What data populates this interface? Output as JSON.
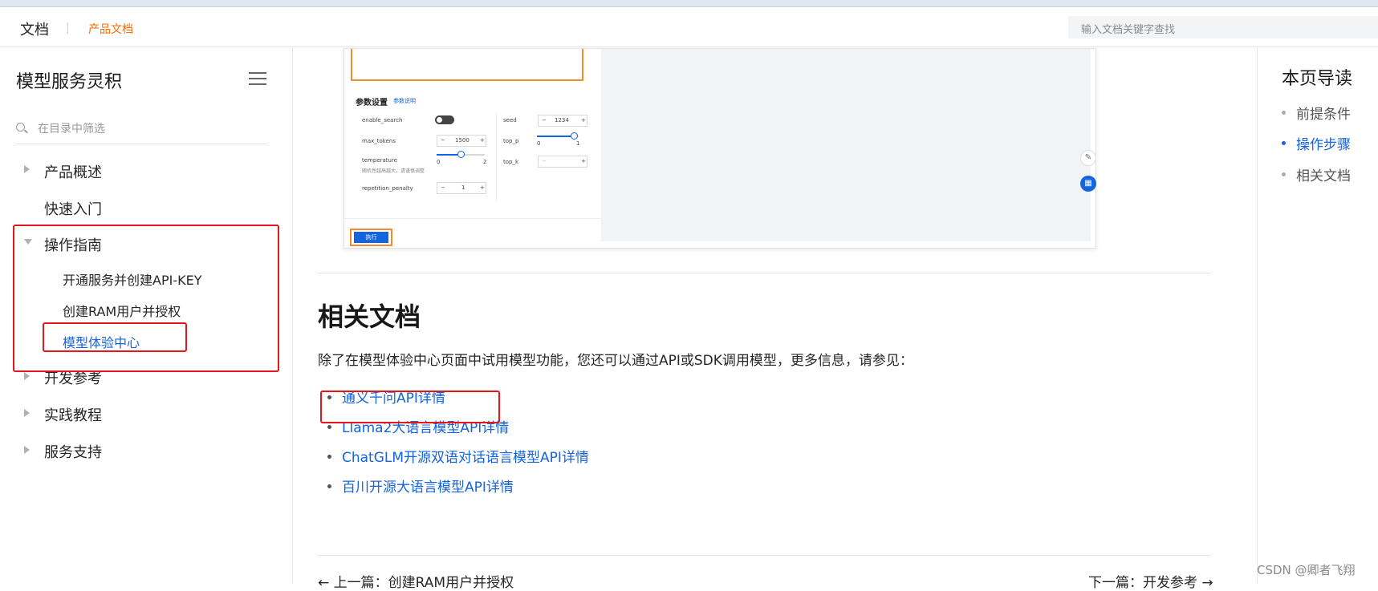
{
  "header": {
    "brand": "文档",
    "breadcrumb": "产品文档",
    "search_placeholder": "输入文档关键字查找"
  },
  "sidebar": {
    "title": "模型服务灵积",
    "filter_placeholder": "在目录中筛选",
    "items": [
      {
        "label": "产品概述",
        "expandable": true
      },
      {
        "label": "快速入门",
        "expandable": false
      },
      {
        "label": "操作指南",
        "expandable": true,
        "expanded": true
      },
      {
        "label": "开发参考",
        "expandable": true
      },
      {
        "label": "实践教程",
        "expandable": true
      },
      {
        "label": "服务支持",
        "expandable": true
      }
    ],
    "sub_items": [
      {
        "label": "开通服务并创建API-KEY"
      },
      {
        "label": "创建RAM用户并授权"
      },
      {
        "label": "模型体验中心",
        "active": true
      }
    ]
  },
  "screenshot_panel": {
    "section_title": "参数设置",
    "section_link": "参数说明",
    "params": {
      "enable_search": "enable_search",
      "seed": "seed",
      "seed_value": "1234",
      "max_tokens": "max_tokens",
      "max_tokens_value": "1500",
      "top_p": "top_p",
      "temperature": "temperature",
      "temperature_hint": "随机性越高越大，请谨慎调整",
      "top_k": "top_k",
      "repetition_penalty": "repetition_penalty",
      "repetition_penalty_value": "1",
      "slider_min": "0",
      "slider_max_temp": "2",
      "slider_max_topp": "1"
    },
    "run_button": "执行"
  },
  "main": {
    "related_heading": "相关文档",
    "intro": "除了在模型体验中心页面中试用模型功能，您还可以通过API或SDK调用模型，更多信息，请参见：",
    "links": [
      "通义千问API详情",
      "Llama2大语言模型API详情",
      "ChatGLM开源双语对话语言模型API详情",
      "百川开源大语言模型API详情"
    ],
    "prev": "上一篇：创建RAM用户并授权",
    "next": "下一篇：开发参考"
  },
  "toc": {
    "title": "本页导读",
    "items": [
      {
        "label": "前提条件",
        "active": false
      },
      {
        "label": "操作步骤",
        "active": true
      },
      {
        "label": "相关文档",
        "active": false
      }
    ]
  },
  "watermark": "CSDN @卿者飞翔",
  "colors": {
    "accent": "#1464e0",
    "brand_orange": "#ff6a00",
    "annotation_red": "#e3171c"
  }
}
